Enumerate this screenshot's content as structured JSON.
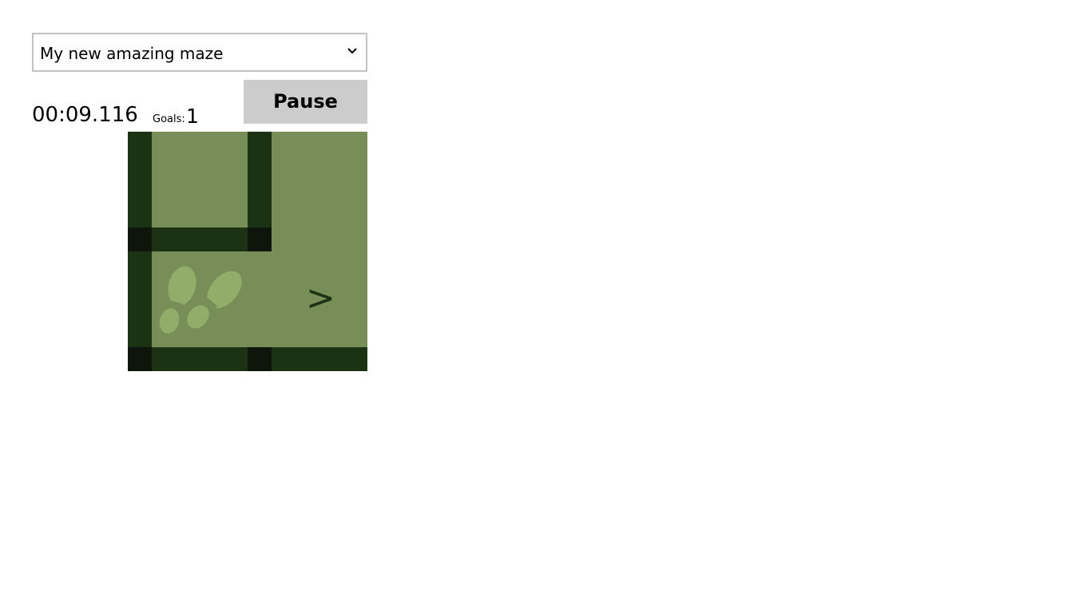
{
  "maze_selector": {
    "selected": "My new amazing maze",
    "icon": "chevron-down-icon"
  },
  "status": {
    "timer": "00:09.116",
    "goals_label": "Goals:",
    "goals_value": "1"
  },
  "controls": {
    "pause_label": "Pause"
  },
  "maze": {
    "goal_marker": ">",
    "player_icon": "footprints-icon",
    "colors": {
      "floor": "#778e58",
      "wall": "#1b3313",
      "wall_junction": "#0e160b",
      "player": "#91ad69",
      "goal": "#1b3313"
    }
  }
}
